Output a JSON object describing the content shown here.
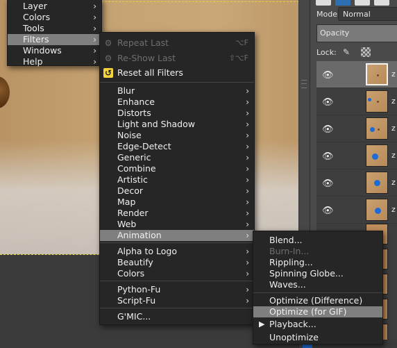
{
  "main_menu": {
    "items": [
      {
        "label": "Layer"
      },
      {
        "label": "Colors"
      },
      {
        "label": "Tools"
      },
      {
        "label": "Filters"
      },
      {
        "label": "Windows"
      },
      {
        "label": "Help"
      }
    ]
  },
  "filters_menu": {
    "repeat_last": {
      "label": "Repeat Last",
      "shortcut": "⌥F"
    },
    "reshow_last": {
      "label": "Re-Show Last",
      "shortcut": "⇧⌥F"
    },
    "reset_all": {
      "label": "Reset all Filters"
    },
    "group1": [
      "Blur",
      "Enhance",
      "Distorts",
      "Light and Shadow",
      "Noise",
      "Edge-Detect",
      "Generic",
      "Combine",
      "Artistic",
      "Decor",
      "Map",
      "Render",
      "Web",
      "Animation"
    ],
    "group2": [
      "Alpha to Logo",
      "Beautify",
      "Colors"
    ],
    "group3": [
      "Python-Fu",
      "Script-Fu"
    ],
    "group4": [
      "G'MIC..."
    ]
  },
  "animation_menu": {
    "group1": [
      "Blend...",
      "Burn-In...",
      "Rippling...",
      "Spinning Globe...",
      "Waves..."
    ],
    "group2": [
      "Optimize (Difference)",
      "Optimize (for GIF)",
      "Playback...",
      "Unoptimize"
    ]
  },
  "layers_dock": {
    "mode_label": "Mode:",
    "mode_value": "Normal",
    "opacity_label": "Opacity",
    "lock_label": "Lock:",
    "row_letter": "z"
  },
  "colors": {
    "menu_bg": "#262626",
    "menu_highlight": "#7f7f7f",
    "disabled_text": "#6e6e6e",
    "selection_dash": "#e8d23a",
    "layer_dot": "#1f6bd6"
  },
  "icons": {
    "reset": "reset-filters-icon",
    "repeat": "repeat-icon",
    "reshow": "reshow-icon",
    "eye": "eye-icon",
    "submenu": "chevron-right-icon",
    "play": "play-icon"
  }
}
